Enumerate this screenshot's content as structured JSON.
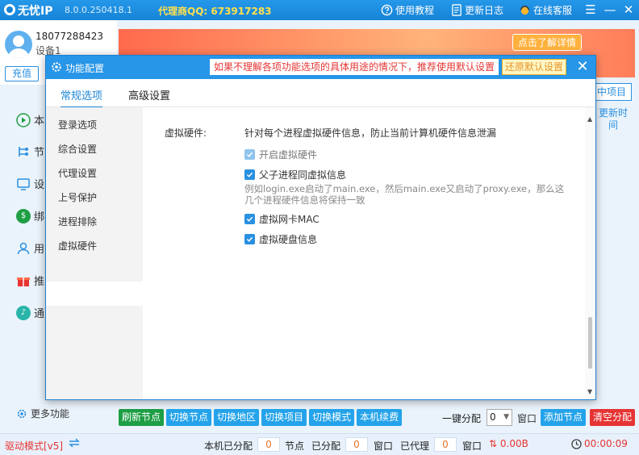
{
  "app": {
    "name": "无忧IP",
    "version": "8.0.0.250418.1",
    "agent_qq": "代理商QQ:  673917283",
    "links": {
      "tutorial": "使用教程",
      "changelog": "更新日志",
      "support": "在线客服"
    }
  },
  "user": {
    "phone": "18077288423",
    "device": "设备1",
    "recharge": "充值"
  },
  "sidebar": {
    "items": [
      {
        "label": "本",
        "icon": "play-icon"
      },
      {
        "label": "节",
        "icon": "nodes-icon"
      },
      {
        "label": "设",
        "icon": "device-icon"
      },
      {
        "label": "绑",
        "icon": "bind-icon"
      },
      {
        "label": "用",
        "icon": "user-icon"
      },
      {
        "label": "推",
        "icon": "gift-icon"
      },
      {
        "label": "通",
        "icon": "bell-icon"
      }
    ],
    "more": "更多功能"
  },
  "banner": {
    "detail": "点击了解详情"
  },
  "right": {
    "project_btn": "中项目",
    "update_time": "更新时间"
  },
  "dialog": {
    "title": "功能配置",
    "warning": "如果不理解各项功能选项的具体用途的情况下，推荐使用默认设置",
    "restore": "还原默认设置",
    "tabs": [
      "常规选项",
      "高级设置"
    ],
    "categories": [
      "登录选项",
      "综合设置",
      "代理设置",
      "上号保护",
      "进程排除",
      "虚拟硬件"
    ],
    "selected_category": "虚拟硬件",
    "section_label": "虚拟硬件:",
    "section_desc": "针对每个进程虚拟硬件信息，防止当前计算机硬件信息泄漏",
    "options": [
      {
        "label": "开启虚拟硬件",
        "checked": true,
        "enabled": false
      },
      {
        "label": "父子进程同虚拟信息",
        "checked": true,
        "enabled": true
      },
      {
        "label": "虚拟网卡MAC",
        "checked": true,
        "enabled": true
      },
      {
        "label": "虚拟硬盘信息",
        "checked": true,
        "enabled": true
      }
    ],
    "note": "例如login.exe启动了main.exe，然后main.exe又启动了proxy.exe，那么这几个进程硬件信息将保持一致"
  },
  "bottom": {
    "buttons": [
      "刷新节点",
      "切换节点",
      "切换地区",
      "切换项目",
      "切换模式",
      "本机续费"
    ],
    "distribute_label": "一键分配",
    "distribute_value": "0",
    "window_label": "窗口",
    "add_node": "添加节点",
    "clear_alloc": "清空分配"
  },
  "status": {
    "mode": "驱动模式[v5]",
    "local_assigned_label": "本机已分配",
    "local_assigned": "0",
    "node_label": "节点",
    "assigned_label": "已分配",
    "assigned": "0",
    "window_label": "窗口",
    "proxied_label": "已代理",
    "proxied": "0",
    "window_label2": "窗口",
    "speed": "0.00B",
    "timer": "00:00:09"
  },
  "colors": {
    "primary": "#2795e8",
    "danger": "#e63434",
    "success": "#1e9e45"
  }
}
